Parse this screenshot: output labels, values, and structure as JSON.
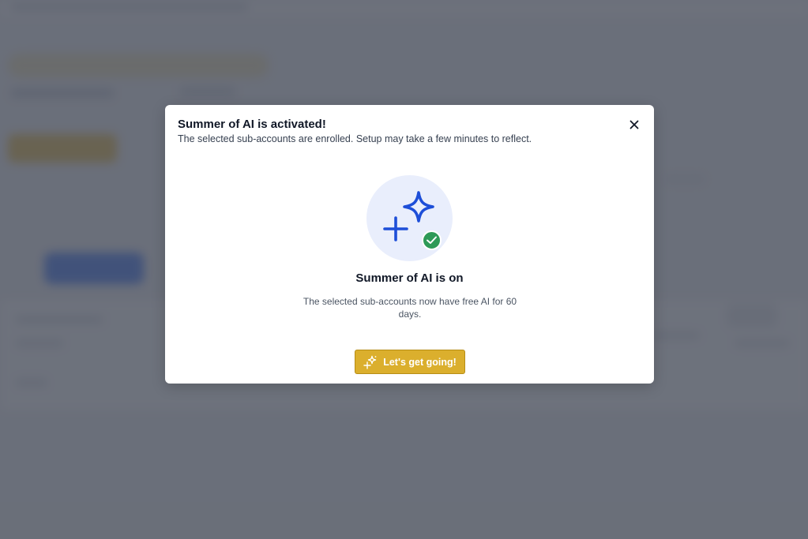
{
  "modal": {
    "title": "Summer of AI is activated!",
    "subtitle": "The selected sub-accounts are enrolled. Setup may take a few minutes to reflect.",
    "close_icon": "close-icon",
    "hero_icon": "sparkles-icon",
    "badge_icon": "checkmark-icon",
    "status_heading": "Summer of AI is on",
    "status_body": "The selected sub-accounts now have free AI for 60 days.",
    "cta_label": "Let's get going!",
    "cta_icon": "sparkles-icon"
  },
  "colors": {
    "accent_blue": "#1d4ed8",
    "cta_gold": "#dbaf2d",
    "success_green": "#2e9a57",
    "hero_bg": "#e9eefc"
  }
}
